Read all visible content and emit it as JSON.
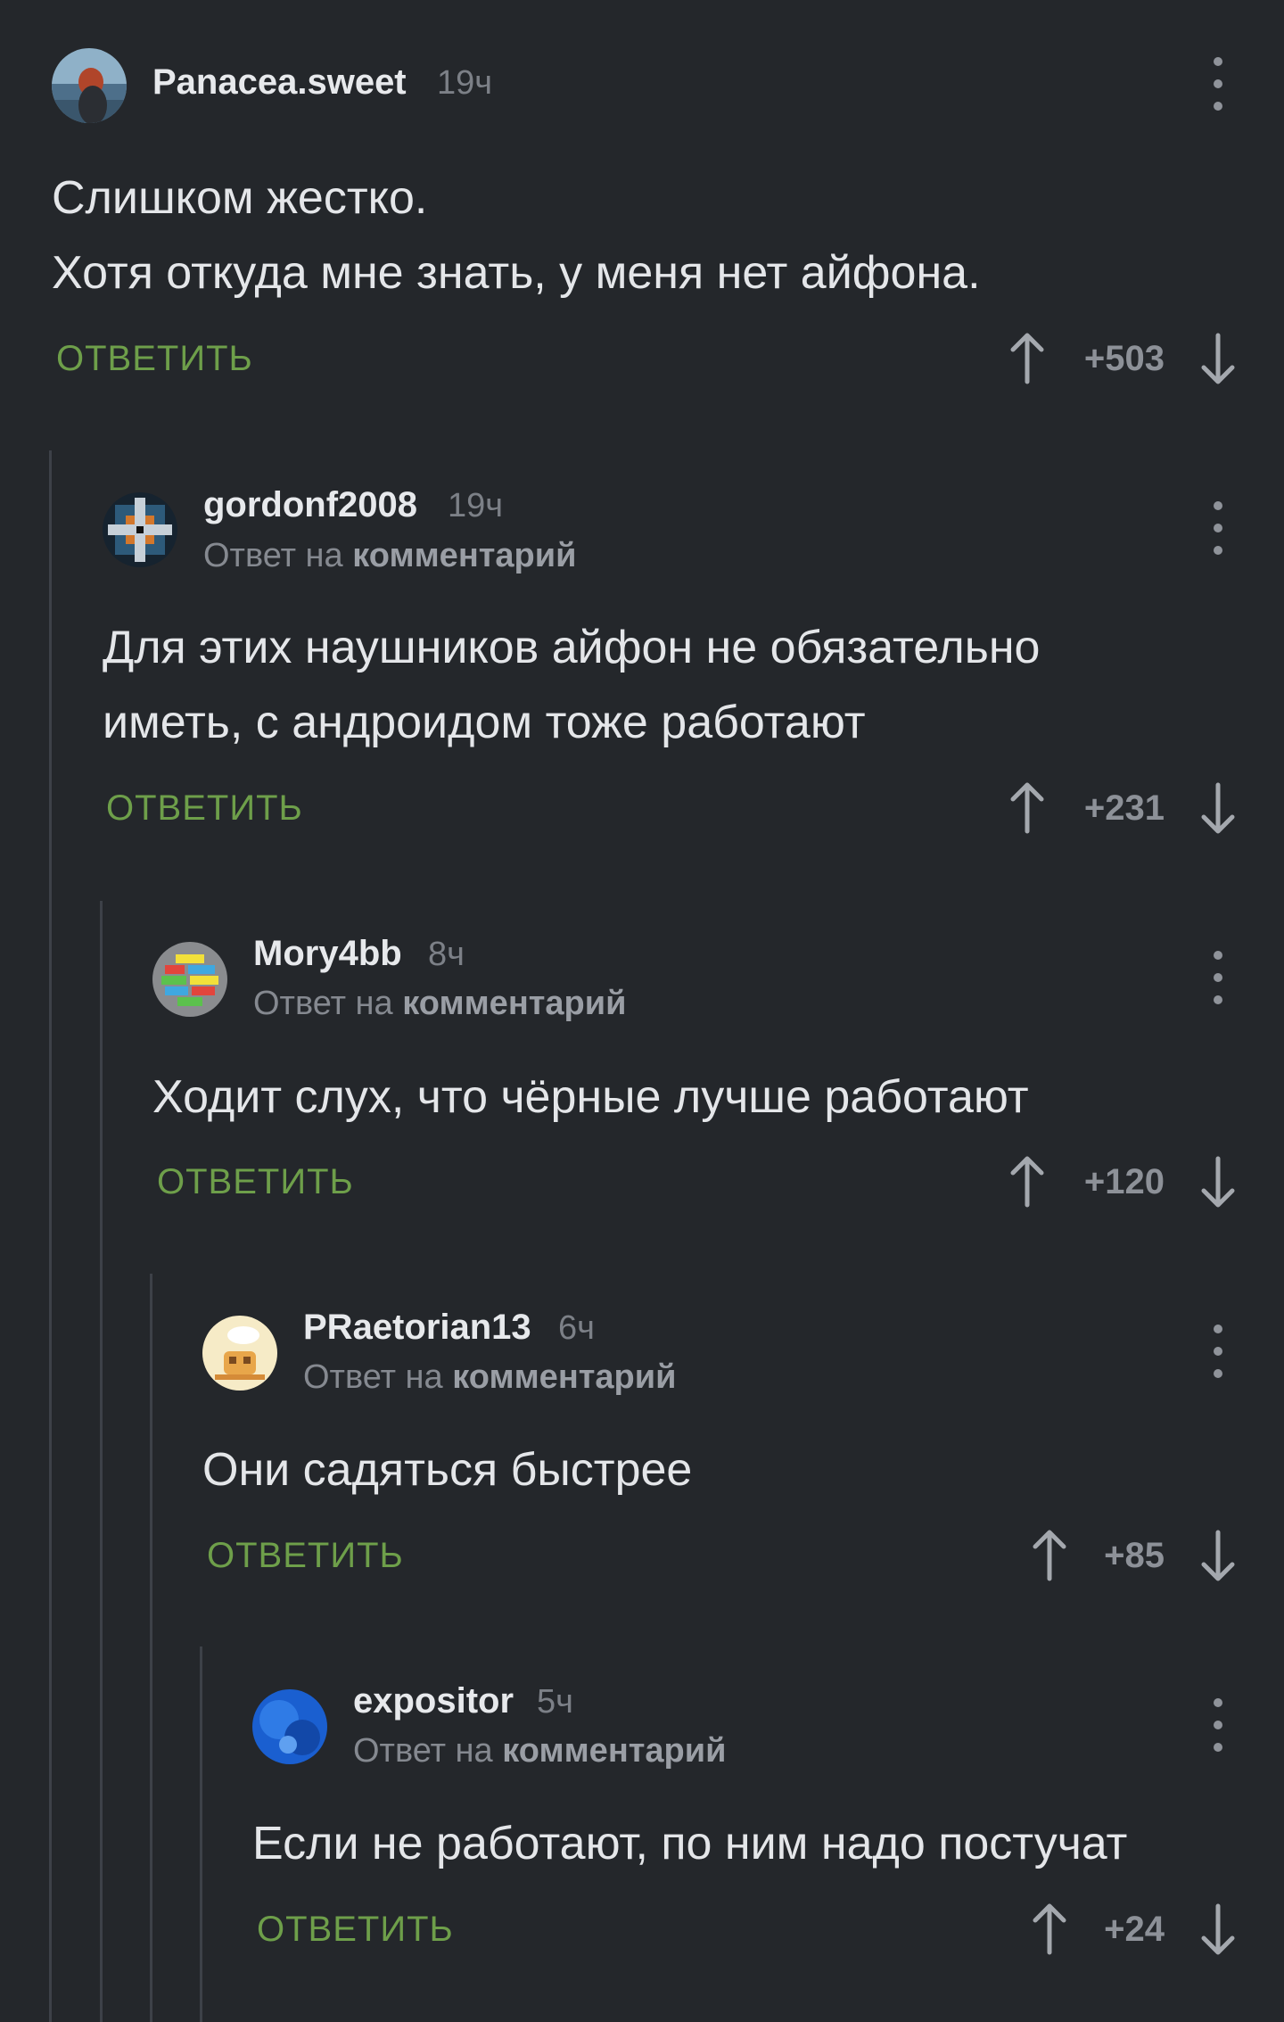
{
  "comments": [
    {
      "author": "Panacea.sweet",
      "time": "19ч",
      "text": "Слишком жестко.\nХотя откуда мне знать, у меня нет айфона.",
      "reply_label": "ОТВЕТИТЬ",
      "score": "+503",
      "reply_prefix": "",
      "reply_target": ""
    },
    {
      "author": "gordonf2008",
      "time": "19ч",
      "text": "Для этих наушников айфон не обязательно\nиметь, с андроидом тоже работают",
      "reply_label": "ОТВЕТИТЬ",
      "score": "+231",
      "reply_prefix": "Ответ на ",
      "reply_target": "комментарий"
    },
    {
      "author": "Mory4bb",
      "time": "8ч",
      "text": "Ходит слух, что чёрные лучше работают",
      "reply_label": "ОТВЕТИТЬ",
      "score": "+120",
      "reply_prefix": "Ответ на ",
      "reply_target": "комментарий"
    },
    {
      "author": "PRaetorian13",
      "time": "6ч",
      "text": "Они садяться быстрее",
      "reply_label": "ОТВЕТИТЬ",
      "score": "+85",
      "reply_prefix": "Ответ на ",
      "reply_target": "комментарий"
    },
    {
      "author": "expositor",
      "time": "5ч",
      "text": "Если не работают, по ним надо постучат",
      "reply_label": "ОТВЕТИТЬ",
      "score": "+24",
      "reply_prefix": "Ответ на ",
      "reply_target": "комментарий"
    }
  ],
  "colors": {
    "background": "#24272b",
    "reply_button": "#6e9f4a",
    "thread_rule": "#3d4148",
    "score": "#8d9198"
  },
  "icons": {
    "vote_up": "arrow-up-icon",
    "vote_down": "arrow-down-icon",
    "menu": "more-vertical-icon"
  }
}
